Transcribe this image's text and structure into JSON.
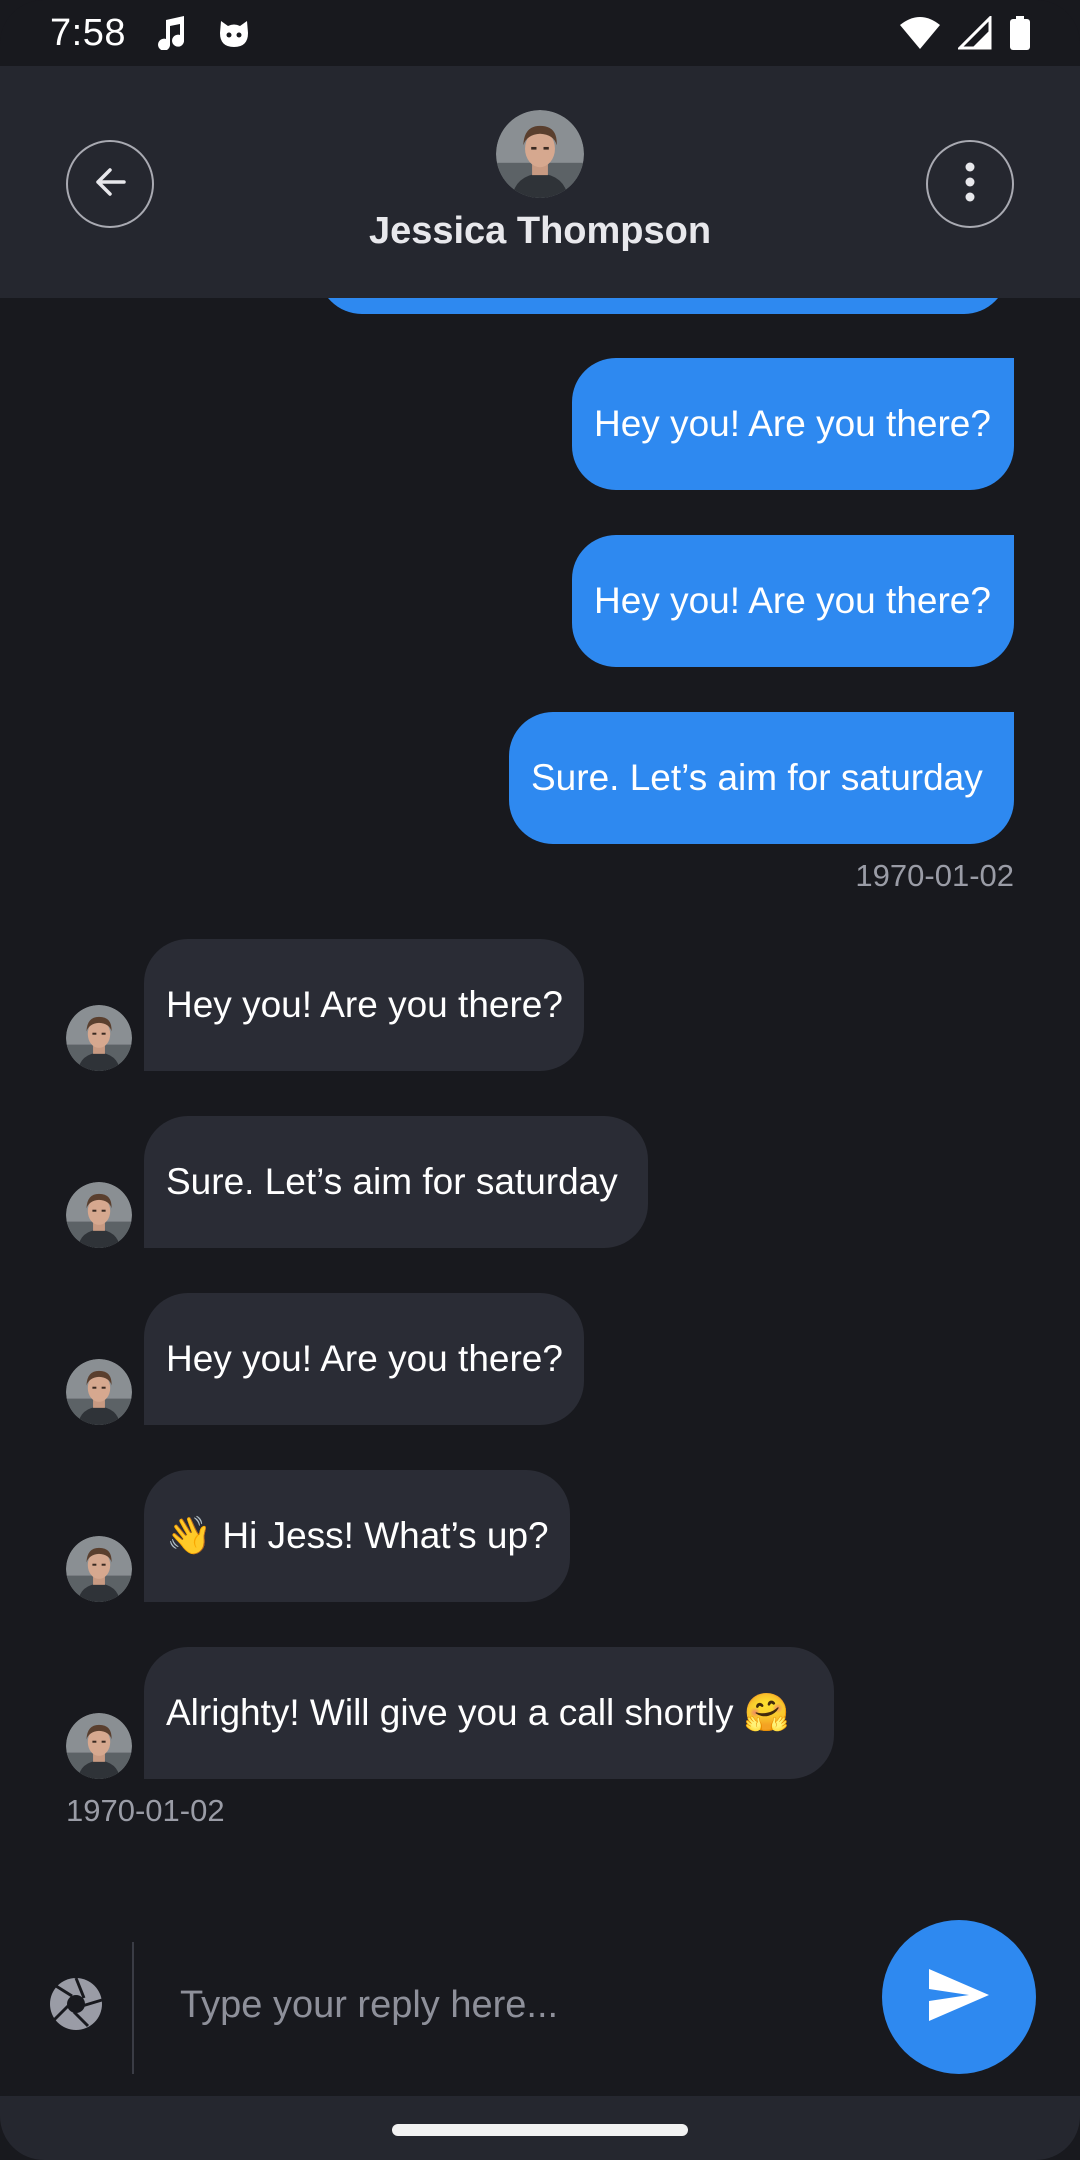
{
  "status_bar": {
    "time": "7:58"
  },
  "header": {
    "contact_name": "Jessica Thompson"
  },
  "messages_outgoing": [
    {
      "text": "Hey you! Are you there?"
    },
    {
      "text": "Hey you! Are you there?"
    },
    {
      "text": "Sure. Let’s aim for saturday"
    }
  ],
  "outgoing_timestamp": "1970-01-02",
  "messages_incoming": [
    {
      "text": "Hey you! Are you there?"
    },
    {
      "text": "Sure. Let’s aim for saturday"
    },
    {
      "text": "Hey you! Are you there?"
    },
    {
      "text": "👋 Hi Jess! What’s up?"
    },
    {
      "text": "Alrighty! Will give you a call shortly 🤗"
    }
  ],
  "incoming_timestamp": "1970-01-02",
  "composer": {
    "placeholder": "Type your reply here..."
  },
  "colors": {
    "accent": "#2e89f0",
    "incoming_bubble": "#2a2c35",
    "header_bg": "#25272f"
  }
}
